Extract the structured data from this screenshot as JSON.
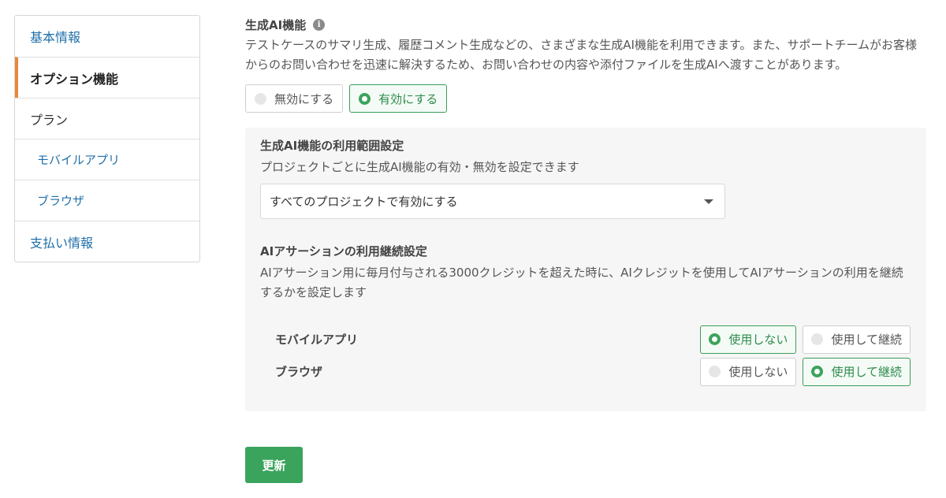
{
  "sidebar": {
    "items": [
      {
        "label": "基本情報"
      },
      {
        "label": "オプション機能"
      },
      {
        "label": "プラン"
      },
      {
        "label": "モバイルアプリ"
      },
      {
        "label": "ブラウザ"
      },
      {
        "label": "支払い情報"
      }
    ]
  },
  "ai_feature": {
    "title": "生成AI機能",
    "info_glyph": "i",
    "description": "テストケースのサマリ生成、履歴コメント生成などの、さまざまな生成AI機能を利用できます。また、サポートチームがお客様からのお問い合わせを迅速に解決するため、お問い合わせの内容や添付ファイルを生成AIへ渡すことがあります。",
    "disable_label": "無効にする",
    "enable_label": "有効にする",
    "selected": "enable"
  },
  "scope": {
    "title": "生成AI機能の利用範囲設定",
    "description": "プロジェクトごとに生成AI機能の有効・無効を設定できます",
    "selected_value": "すべてのプロジェクトで有効にする"
  },
  "assertion": {
    "title": "AIアサーションの利用継続設定",
    "description": "AIアサーション用に毎月付与される3000クレジットを超えた時に、AIクレジットを使用してAIアサーションの利用を継続するかを設定します",
    "rows": [
      {
        "label": "モバイルアプリ",
        "no_label": "使用しない",
        "yes_label": "使用して継続",
        "selected": "no"
      },
      {
        "label": "ブラウザ",
        "no_label": "使用しない",
        "yes_label": "使用して継続",
        "selected": "yes"
      }
    ]
  },
  "submit_label": "更新",
  "colors": {
    "accent_green": "#3aa35c",
    "link_blue": "#1f6fa8",
    "active_marker": "#e8873a"
  }
}
